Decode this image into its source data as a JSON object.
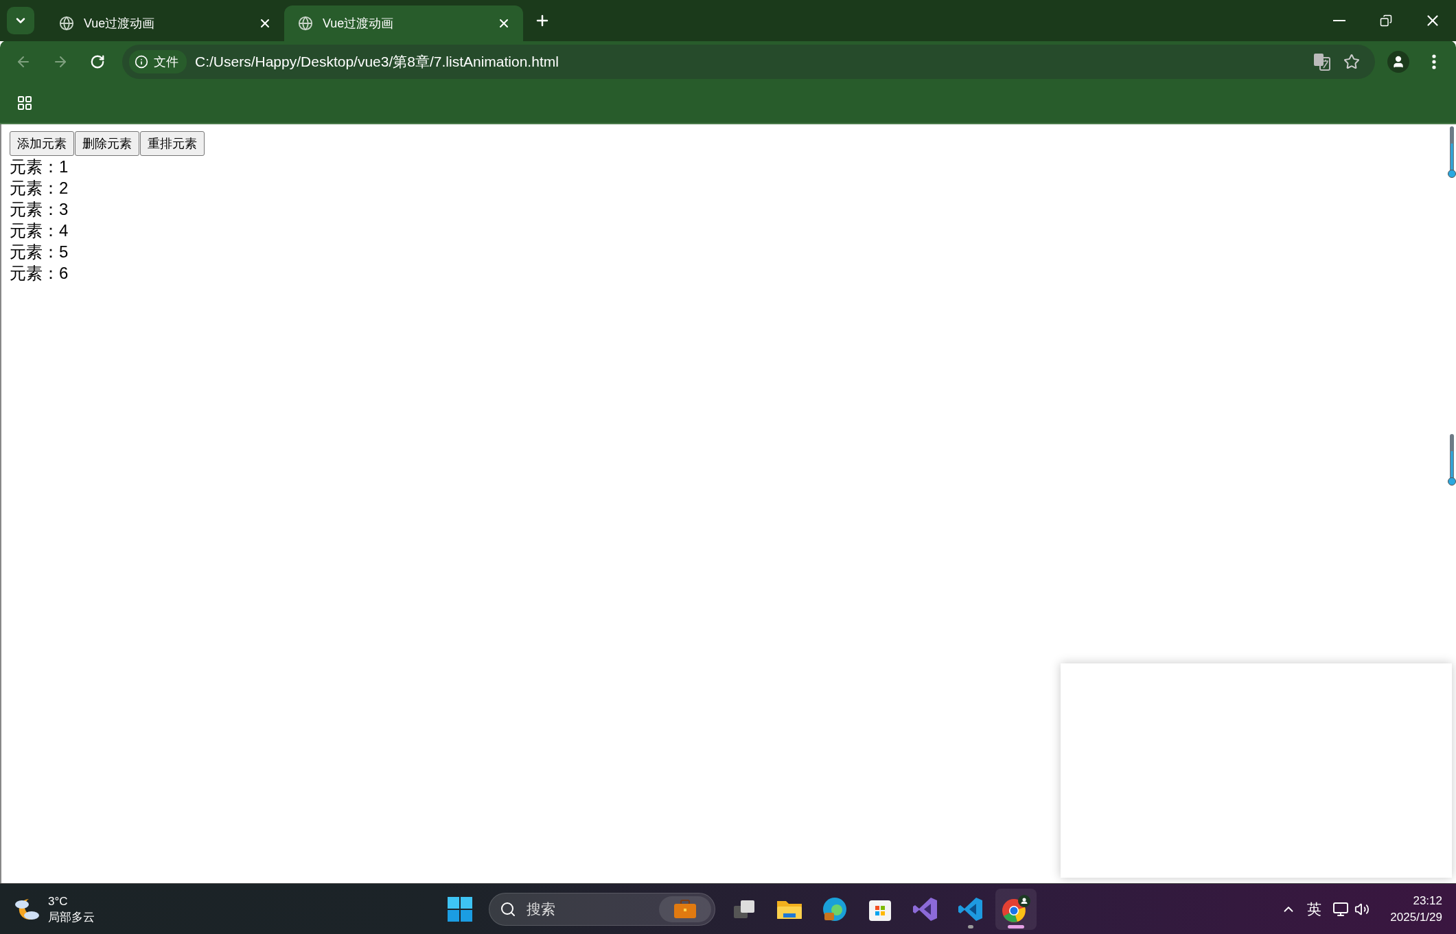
{
  "tabs": [
    {
      "title": "Vue过渡动画",
      "selected": false
    },
    {
      "title": "Vue过渡动画",
      "selected": true
    }
  ],
  "address_bar": {
    "security_label": "文件",
    "url": "C:/Users/Happy/Desktop/vue3/第8章/7.listAnimation.html"
  },
  "page": {
    "buttons": [
      "添加元素",
      "删除元素",
      "重排元素"
    ],
    "items": [
      "元素：1",
      "元素：2",
      "元素：3",
      "元素：4",
      "元素：5",
      "元素：6"
    ]
  },
  "taskbar": {
    "weather": {
      "temperature": "3°C",
      "condition": "局部多云"
    },
    "search": {
      "placeholder": "搜索"
    },
    "apps": [
      {
        "kind": "taskview",
        "open": false,
        "selected": false
      },
      {
        "kind": "explorer",
        "open": false,
        "selected": false
      },
      {
        "kind": "edge",
        "open": false,
        "selected": false
      },
      {
        "kind": "store",
        "open": false,
        "selected": false
      },
      {
        "kind": "visualstudio",
        "open": false,
        "selected": false
      },
      {
        "kind": "vscode",
        "open": true,
        "selected": false
      },
      {
        "kind": "chrome",
        "open": true,
        "selected": true
      }
    ],
    "input_method": "英",
    "time": "23:12",
    "date": "2025/1/29"
  }
}
